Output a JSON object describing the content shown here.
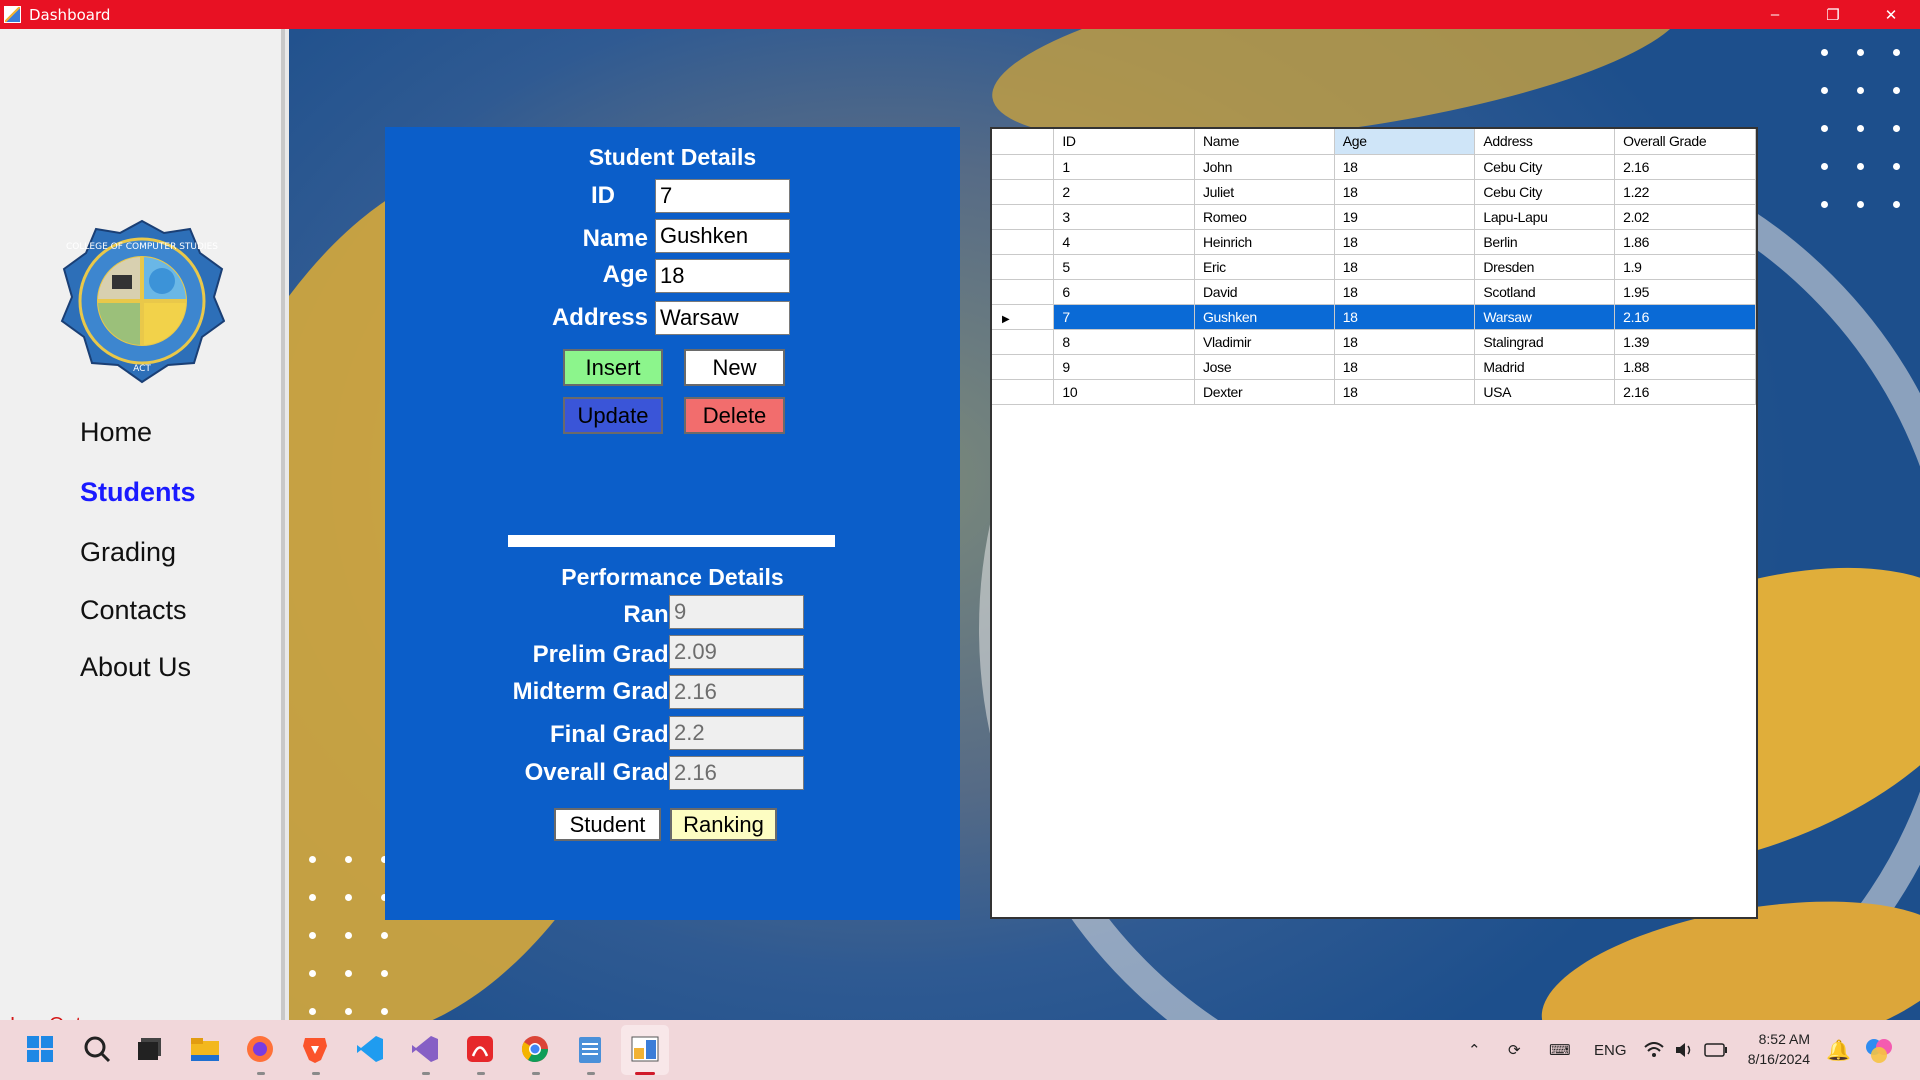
{
  "window": {
    "title": "Dashboard",
    "minimize": "–",
    "maximize": "❐",
    "close": "✕"
  },
  "sidebar": {
    "nav": [
      {
        "label": "Home",
        "active": false
      },
      {
        "label": "Students",
        "active": true
      },
      {
        "label": "Grading",
        "active": false
      },
      {
        "label": "Contacts",
        "active": false
      },
      {
        "label": "About Us",
        "active": false
      }
    ],
    "logout": "Log Out",
    "logo_ring_text": "COLLEGE OF COMPUTER STUDIES",
    "logo_bottom_text": "ACT"
  },
  "student": {
    "title": "Student Details",
    "id_label": "ID",
    "id_value": "7",
    "name_label": "Name",
    "name_value": "Gushken",
    "age_label": "Age",
    "age_value": "18",
    "address_label": "Address",
    "address_value": "Warsaw",
    "insert": "Insert",
    "new": "New",
    "update": "Update",
    "delete": "Delete"
  },
  "performance": {
    "title": "Performance Details",
    "rank_label": "Rank:",
    "rank_value": "9",
    "prelim_label": "Prelim Grade:",
    "prelim_value": "2.09",
    "midterm_label": "Midterm Grade:",
    "midterm_value": "2.16",
    "final_label": "Final Grade:",
    "final_value": "2.2",
    "overall_label": "Overall Grade:",
    "overall_value": "2.16",
    "student_btn": "Student",
    "ranking_btn": "Ranking"
  },
  "grid": {
    "columns": [
      "ID",
      "Name",
      "Age",
      "Address",
      "Overall Grade"
    ],
    "rows": [
      [
        "1",
        "John",
        "18",
        "Cebu City",
        "2.16"
      ],
      [
        "2",
        "Juliet",
        "18",
        "Cebu City",
        "1.22"
      ],
      [
        "3",
        "Romeo",
        "19",
        "Lapu-Lapu",
        "2.02"
      ],
      [
        "4",
        "Heinrich",
        "18",
        "Berlin",
        "1.86"
      ],
      [
        "5",
        "Eric",
        "18",
        "Dresden",
        "1.9"
      ],
      [
        "6",
        "David",
        "18",
        "Scotland",
        "1.95"
      ],
      [
        "7",
        "Gushken",
        "18",
        "Warsaw",
        "2.16"
      ],
      [
        "8",
        "Vladimir",
        "18",
        "Stalingrad",
        "1.39"
      ],
      [
        "9",
        "Jose",
        "18",
        "Madrid",
        "1.88"
      ],
      [
        "10",
        "Dexter",
        "18",
        "USA",
        "2.16"
      ]
    ],
    "selected_row": 6,
    "highlighted_column": 2
  },
  "taskbar": {
    "apps": [
      "windows-start-icon",
      "search-icon",
      "task-view-icon",
      "file-explorer-icon",
      "firefox-icon",
      "brave-icon",
      "vscode-icon",
      "visual-studio-icon",
      "adobe-acrobat-icon",
      "chrome-icon",
      "notepad-icon",
      "dashboard-app-icon"
    ],
    "language": "ENG",
    "time": "8:52 AM",
    "date": "8/16/2024"
  },
  "colors": {
    "titlebar": "#e81123",
    "panel": "#0b5ec9",
    "insert": "#8cf58c",
    "update": "#3a55d8",
    "delete": "#f26d6d",
    "ranking": "#fdfdc2",
    "selection": "#0a6ad6",
    "active_nav": "#1a1aff"
  }
}
